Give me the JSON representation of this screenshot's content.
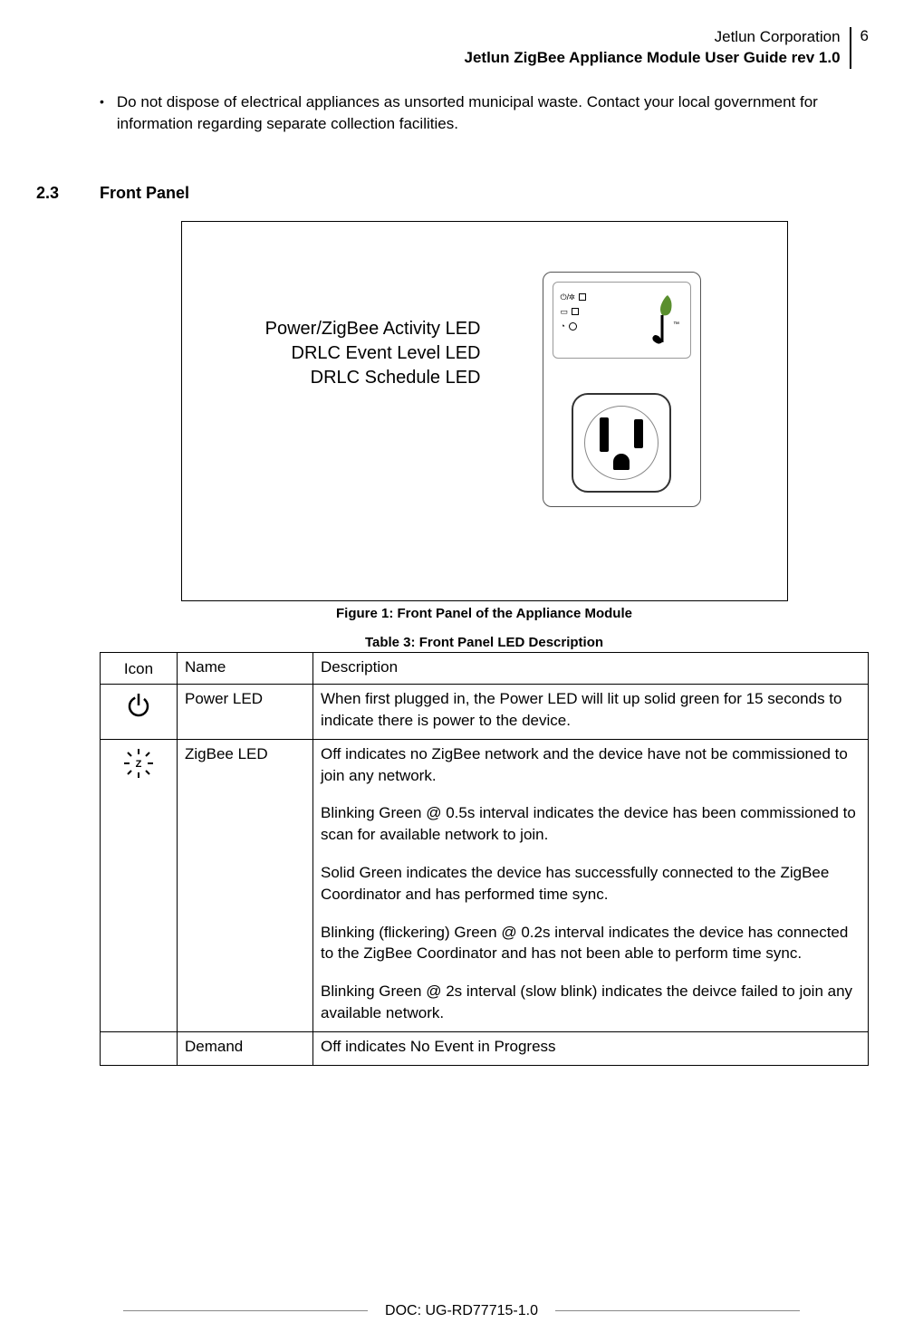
{
  "header": {
    "company": "Jetlun Corporation",
    "title": "Jetlun ZigBee Appliance Module User Guide rev 1.0",
    "page": "6"
  },
  "bullet": "Do not dispose of electrical appliances as unsorted municipal waste. Contact your local government for information regarding separate collection facilities.",
  "section": {
    "num": "2.3",
    "title": "Front Panel"
  },
  "figure": {
    "labels": {
      "l1": "Power/ZigBee Activity LED",
      "l2": "DRLC Event Level LED",
      "l3": "DRLC Schedule LED"
    },
    "caption": "Figure 1: Front Panel of the Appliance Module"
  },
  "table": {
    "caption": "Table 3: Front Panel LED Description",
    "headers": {
      "icon": "Icon",
      "name": "Name",
      "desc": "Description"
    },
    "rows": [
      {
        "icon": "power",
        "name": "Power LED",
        "desc_paras": [
          "When first plugged in, the Power LED will lit up solid green for 15 seconds to indicate there is power to the device."
        ]
      },
      {
        "icon": "zigbee",
        "name": "ZigBee LED",
        "desc_paras": [
          "Off indicates no ZigBee network and the device have not be commissioned to join any network.",
          "Blinking Green @ 0.5s interval indicates the device has been commissioned to scan for available network to join.",
          "Solid Green indicates the device has successfully connected to the ZigBee Coordinator and has performed time sync.",
          "Blinking (flickering) Green @ 0.2s interval indicates the device has connected to the ZigBee Coordinator and has not been able to perform time sync.",
          "Blinking Green @ 2s interval (slow blink) indicates the deivce failed to join any available network."
        ]
      },
      {
        "icon": "",
        "name": "Demand",
        "desc_paras": [
          "Off indicates No Event in Progress"
        ]
      }
    ]
  },
  "footer": {
    "doc": "DOC: UG-RD77715-1.0"
  }
}
